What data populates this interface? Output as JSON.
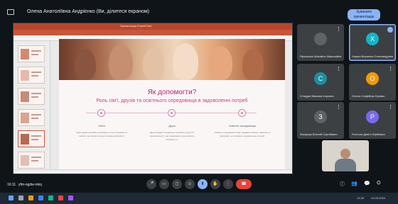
{
  "meeting": {
    "title": "Олена Анатоліївна Андрієнко (Ви, ділитеся екраном)",
    "stop_button": "Зупинити презентацію",
    "time_code": "16:11",
    "meeting_code": "yfm-ngdw-mkq"
  },
  "powerpoint": {
    "window_title": "Презентація PowerPoint",
    "slide": {
      "heading": "Як допомогти?",
      "subheading": "Роль сім'ї, друзів та освітнього середовища в задоволенні потреб",
      "columns": [
        {
          "title": "Сім'я",
          "text": "Сім'я надає емоційну підтримку, почуття безпеки та любові, що сприяє психологічному добробуту."
        },
        {
          "title": "Друзі",
          "text": "Друзі надають соціальну підтримку, відчуття приналежності, що є важливим для розвитку особистості."
        },
        {
          "title": "Освітнє середовище",
          "text": "Освітнє середовище може надавати знання, навички та підтримку, що сприяють задоволенню потреб."
        }
      ]
    }
  },
  "participants": [
    {
      "name": "Ярошенко Михайло Миколайович",
      "avatar_letter": "",
      "avatar_color": "#5f6368",
      "speaking": false
    },
    {
      "name": "Хариш Вероніка Олександрівна",
      "avatar_letter": "X",
      "avatar_color": "#12b5cb",
      "speaking": true
    },
    {
      "name": "Стацура Максим Ігорович",
      "avatar_letter": "C",
      "avatar_color": "#1e8e9e",
      "speaking": false
    },
    {
      "name": "Олеся Стафійчук Бровко",
      "avatar_letter": "O",
      "avatar_color": "#f29900",
      "speaking": false
    },
    {
      "name": "Захарчук Віталій Сергійович",
      "avatar_letter": "З",
      "avatar_color": "#5f6368",
      "speaking": false
    },
    {
      "name": "Ростопа Даніїл Юрійович",
      "avatar_letter": "P",
      "avatar_color": "#7b68ee",
      "speaking": false
    }
  ],
  "controls": {
    "mic_icon": "mic-icon",
    "camera_icon": "camera-icon",
    "captions_icon": "captions-icon",
    "emoji_icon": "emoji-icon",
    "present_icon": "present-icon",
    "hand_icon": "hand-icon",
    "more_icon": "more-icon",
    "end_icon": "end-call-icon"
  },
  "taskbar": {
    "clock": "12:35",
    "date": "14.05.2024"
  },
  "colors": {
    "accent": "#8ab4f8",
    "end_call": "#ea4335",
    "slide_heading": "#b1266e",
    "ppt_red": "#b7472a"
  }
}
